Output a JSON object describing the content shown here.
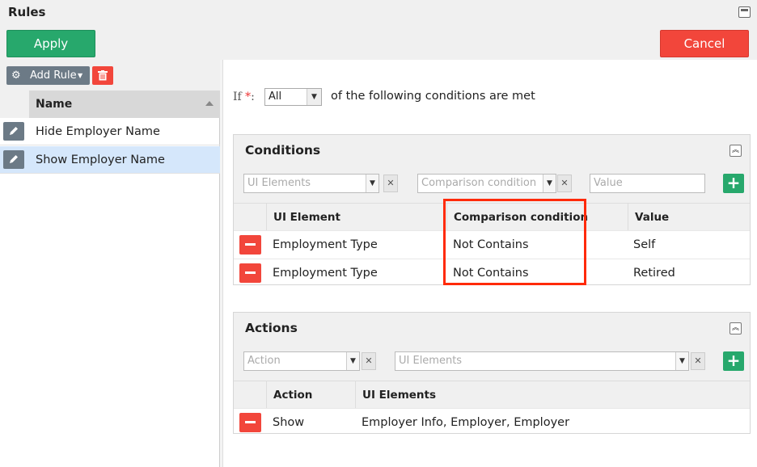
{
  "window": {
    "title": "Rules"
  },
  "toolbar": {
    "apply_label": "Apply",
    "cancel_label": "Cancel"
  },
  "rules_list": {
    "add_rule_label": "Add Rule",
    "column_header": "Name",
    "items": [
      {
        "name": "Hide Employer Name",
        "selected": false
      },
      {
        "name": "Show Employer Name",
        "selected": true
      }
    ]
  },
  "condition_mode": {
    "if_label": "If",
    "required_mark": "*",
    "colon": ":",
    "selected": "All",
    "suffix": "of the following conditions are met"
  },
  "conditions": {
    "title": "Conditions",
    "filters": {
      "ui_elements_placeholder": "UI Elements",
      "comparison_placeholder": "Comparison condition",
      "value_placeholder": "Value"
    },
    "columns": [
      "UI Element",
      "Comparison condition",
      "Value"
    ],
    "rows": [
      {
        "ui_element": "Employment Type",
        "comparison": "Not Contains",
        "value": "Self"
      },
      {
        "ui_element": "Employment Type",
        "comparison": "Not Contains",
        "value": "Retired"
      }
    ]
  },
  "actions": {
    "title": "Actions",
    "filters": {
      "action_placeholder": "Action",
      "ui_elements_placeholder": "UI Elements"
    },
    "columns": [
      "Action",
      "UI Elements"
    ],
    "rows": [
      {
        "action": "Show",
        "ui_elements": "Employer Info, Employer, Employer"
      }
    ]
  },
  "colors": {
    "apply": "#27a86c",
    "cancel": "#f2463b",
    "selected_row": "#d5e7fb",
    "highlight": "#ff2a0a"
  }
}
